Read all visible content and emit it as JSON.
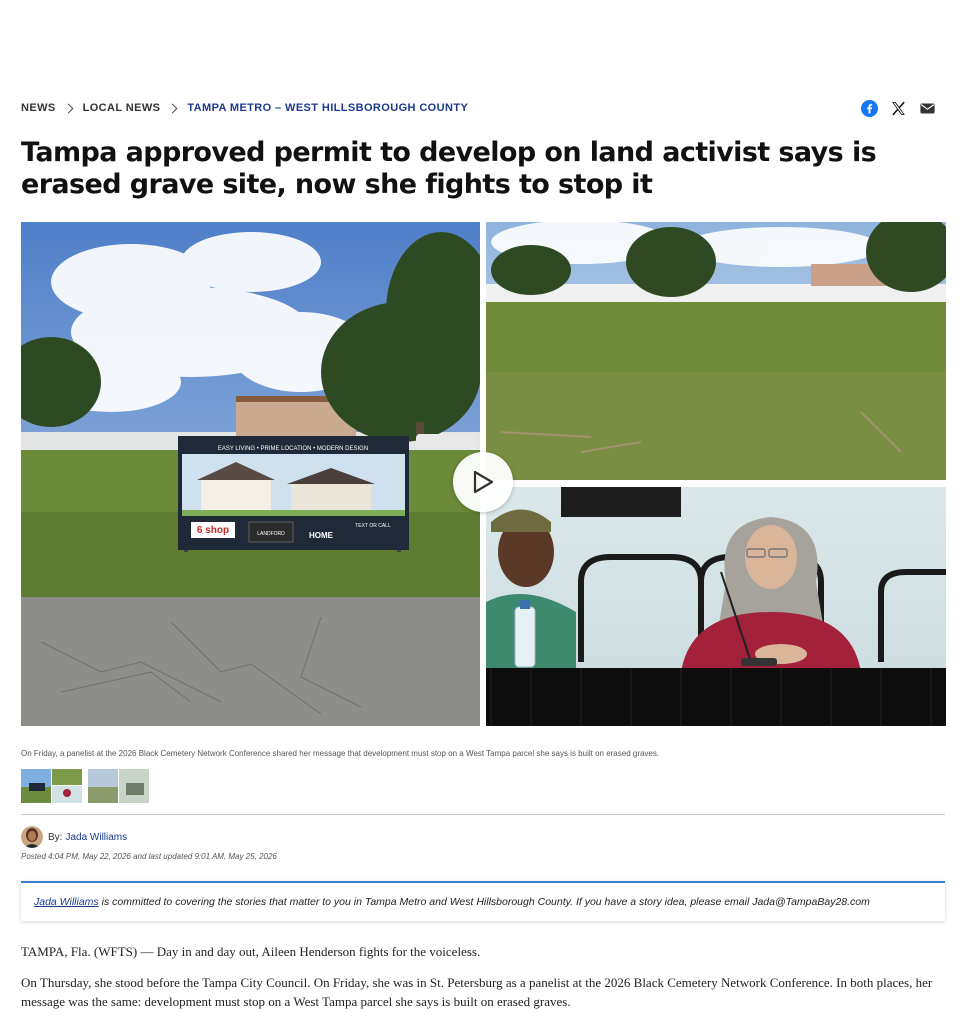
{
  "breadcrumb": {
    "items": [
      "News",
      "Local News",
      "Tampa Metro – West Hillsborough County"
    ]
  },
  "share": {
    "icons": [
      "facebook-icon",
      "x-icon",
      "email-icon"
    ]
  },
  "article": {
    "headline": "Tampa approved permit to develop on land activist says is erased grave site, now she fights to stop it",
    "caption": "On Friday, a panelist at the 2026 Black Cemetery Network Conference shared her message that development must stop on a West Tampa parcel she says is built on erased graves.",
    "sign": {
      "top_text": "EASY LIVING • PRIME LOCATION • MODERN DESIGN",
      "badge": "6 shop",
      "brand": "LANDFORD",
      "home": "HOME",
      "cta": "TEXT OR CALL"
    },
    "byline_prefix": "By:",
    "author": "Jada Williams",
    "posted": "Posted 4:04 PM, May 22, 2026 and last updated 9:01 AM, May 25, 2026",
    "promo_link": "Jada Williams",
    "promo_text": "is committed to covering the stories that matter to you in Tampa Metro and West Hillsborough County. If you have a story idea, please email Jada@TampaBay28.com",
    "paragraphs": [
      "TAMPA, Fla. (WFTS) — Day in and day out, Aileen Henderson fights for the voiceless.",
      "On Thursday, she stood before the Tampa City Council. On Friday, she was in St. Petersburg as a panelist at the 2026 Black Cemetery Network Conference. In both places, her message was the same: development must stop on a West Tampa parcel she says is built on erased graves."
    ]
  },
  "colors": {
    "link": "#1b3a8c",
    "promo_accent": "#3a7fd0",
    "facebook": "#1877f2",
    "sign_badge": "#c62828"
  }
}
